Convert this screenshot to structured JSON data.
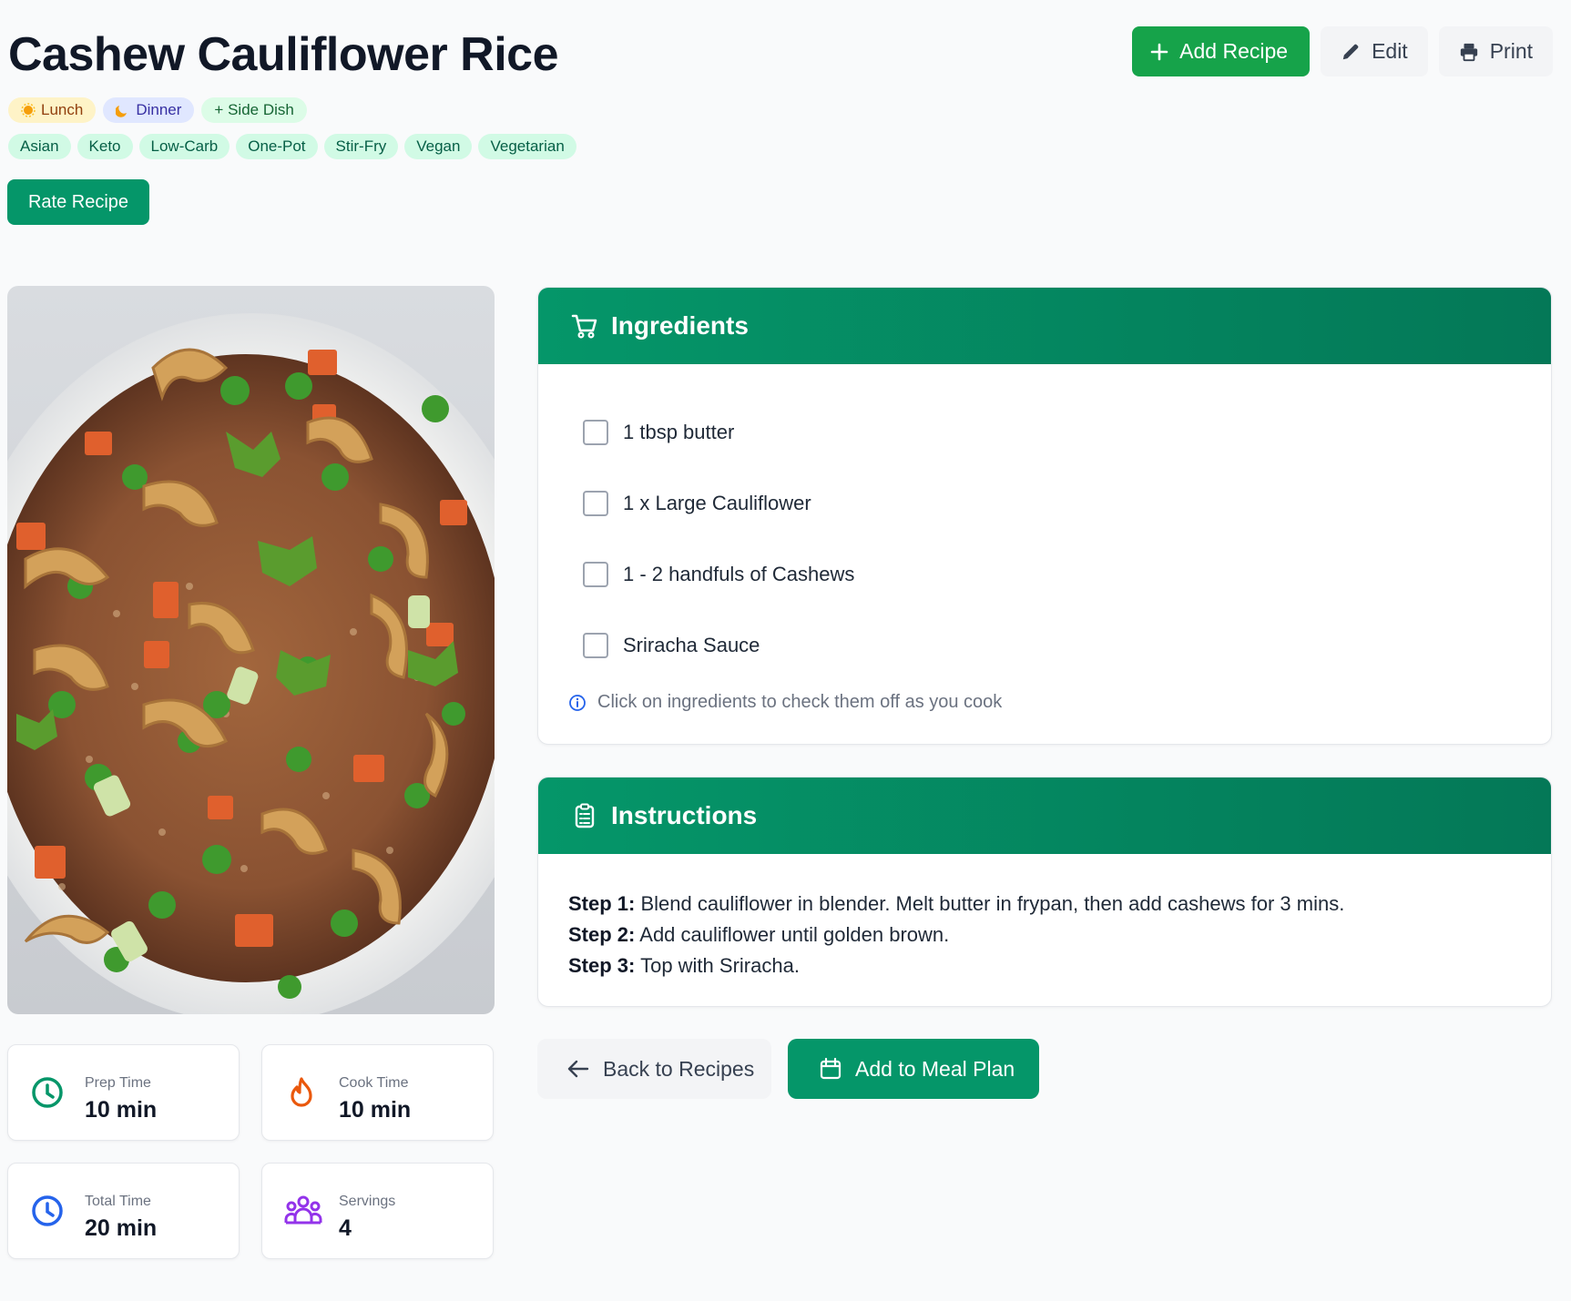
{
  "recipe": {
    "title": "Cashew Cauliflower Rice"
  },
  "header": {
    "add_recipe_label": "Add Recipe",
    "edit_label": "Edit",
    "print_label": "Print"
  },
  "meal_tags": [
    {
      "label": "Lunch",
      "icon": "sun-icon"
    },
    {
      "label": "Dinner",
      "icon": "moon-icon"
    },
    {
      "label": "+ Side Dish"
    }
  ],
  "category_tags": [
    "Asian",
    "Keto",
    "Low-Carb",
    "One-Pot",
    "Stir-Fry",
    "Vegan",
    "Vegetarian"
  ],
  "rate_label": "Rate Recipe",
  "stats": {
    "prep": {
      "label": "Prep Time",
      "value": "10 min",
      "color": "#059669"
    },
    "cook": {
      "label": "Cook Time",
      "value": "10 min",
      "color": "#ea580c"
    },
    "total": {
      "label": "Total Time",
      "value": "20 min",
      "color": "#2563eb"
    },
    "servings": {
      "label": "Servings",
      "value": "4",
      "color": "#9333ea"
    }
  },
  "ingredients": {
    "heading": "Ingredients",
    "items": [
      "1 tbsp butter",
      "1 x Large Cauliflower",
      "1 - 2 handfuls of Cashews",
      "Sriracha Sauce"
    ],
    "hint": "Click on ingredients to check them off as you cook"
  },
  "instructions": {
    "heading": "Instructions",
    "steps": [
      {
        "label": "Step 1:",
        "text": "Blend cauliflower in blender. Melt butter in frypan, then add cashews for 3 mins."
      },
      {
        "label": "Step 2:",
        "text": "Add cauliflower until golden brown."
      },
      {
        "label": "Step 3:",
        "text": "Top with Sriracha."
      }
    ]
  },
  "actions": {
    "back_label": "Back to Recipes",
    "meal_plan_label": "Add to Meal Plan"
  },
  "colors": {
    "brand_green": "#059669",
    "button_green": "#16a34a"
  }
}
